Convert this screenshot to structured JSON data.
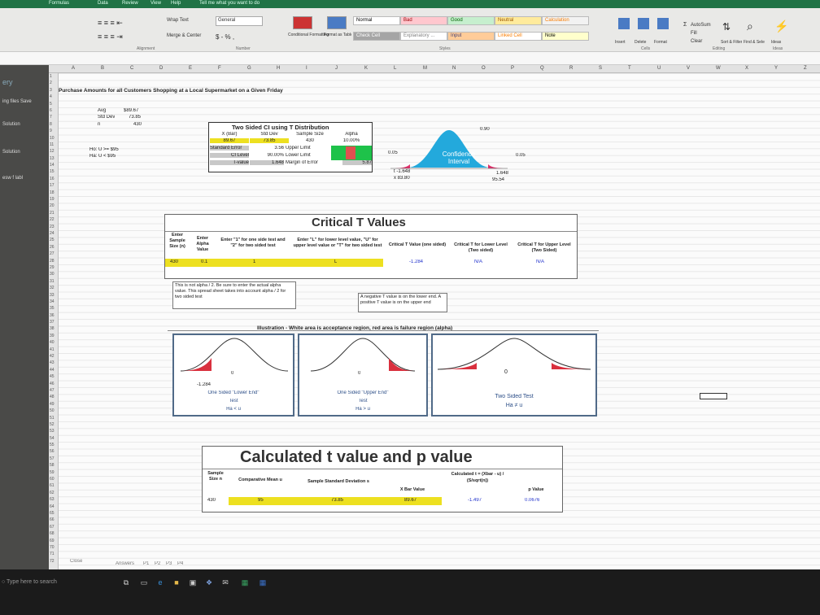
{
  "ribbon": {
    "tabs": [
      "Formulas",
      "Data",
      "Review",
      "View",
      "Help",
      "Tell me what you want to do"
    ],
    "wrap_text": "Wrap Text",
    "merge_center": "Merge & Center",
    "number_format": "General",
    "currency_symbols": "$ - % ,",
    "conditional_formatting": "Conditional Formatting",
    "format_as_table": "Format as Table",
    "styles": [
      {
        "label": "Normal",
        "bg": "#ffffff",
        "fg": "#000000"
      },
      {
        "label": "Bad",
        "bg": "#ffc7ce",
        "fg": "#9c0006"
      },
      {
        "label": "Good",
        "bg": "#c6efce",
        "fg": "#006100"
      },
      {
        "label": "Neutral",
        "bg": "#ffeb9c",
        "fg": "#9c5700"
      },
      {
        "label": "Calculation",
        "bg": "#f2f2f2",
        "fg": "#fa7d00"
      },
      {
        "label": "Check Cell",
        "bg": "#a5a5a5",
        "fg": "#ffffff"
      },
      {
        "label": "Explanatory ...",
        "bg": "#ffffff",
        "fg": "#7f7f7f"
      },
      {
        "label": "Input",
        "bg": "#ffcc99",
        "fg": "#3f3f76"
      },
      {
        "label": "Linked Cell",
        "bg": "#ffffff",
        "fg": "#fa7d00"
      },
      {
        "label": "Note",
        "bg": "#ffffcc",
        "fg": "#000000"
      }
    ],
    "cells": [
      "Insert",
      "Delete",
      "Format"
    ],
    "autosum": "AutoSum",
    "fill": "Fill",
    "clear": "Clear",
    "sort_filter": "Sort & Filter",
    "find_select": "Find & Select",
    "ideas": "Ideas",
    "groups": [
      "Alignment",
      "Number",
      "Styles",
      "Cells",
      "Editing",
      "Ideas"
    ]
  },
  "columns": [
    "A",
    "B",
    "C",
    "D",
    "E",
    "F",
    "G",
    "H",
    "I",
    "J",
    "K",
    "L",
    "M",
    "N",
    "O",
    "P",
    "Q",
    "R",
    "S",
    "T",
    "U",
    "V",
    "W",
    "X",
    "Y",
    "Z"
  ],
  "left_pane": [
    "ery",
    "ing files Save",
    "Solution",
    "Solution",
    "esw f labl"
  ],
  "sheet": {
    "title": "Purchase Amounts for all Customers Shopping at a Local Supermarket on a Given Friday",
    "stats": {
      "avg_label": "Avg",
      "avg": "$89.67",
      "sd_label": "Std Dev",
      "sd": "73.85",
      "n_label": "n",
      "n": "430"
    },
    "hypotheses": {
      "h0": "Ho: U >= $95",
      "ha": "Ha: U < $95"
    },
    "ci_table": {
      "title": "Two Sided CI using T Distribution",
      "headers": [
        "X (Bar)",
        "Std Dev",
        "Sample Size",
        "Alpha"
      ],
      "values": [
        "89.67",
        "73.85",
        "430",
        "10.00%"
      ],
      "row_std_err": {
        "label": "Standard Error",
        "value": "3.56",
        "desc": "Upper Limit"
      },
      "row_ci_level": {
        "label": "CI Level",
        "value": "90.00%",
        "desc": "Lower Limit"
      },
      "row_tvalue": {
        "label": "T-value",
        "value": "1.648",
        "desc": "Margin of Error",
        "moe": "5.87"
      }
    },
    "ci_chart": {
      "center_label": "Confidence Interval",
      "center_value": "0.90",
      "left_tail": "0.05",
      "right_tail": "0.05",
      "t_left": "t  -1.648",
      "x_left": "x  83.80",
      "t_right": "1.648",
      "x_right": "95.54"
    },
    "critical": {
      "title": "Critical T Values",
      "headers": [
        "Enter Sample Size (n)",
        "Enter Alpha Value",
        "Enter \"1\" for one side test and \"2\" for two sided test",
        "Enter \"L\" for lower level value, \"U\" for upper level value or \"T\" for two sided test",
        "Critical T Value (one sided)",
        "Critical T for Lower Level (Two sided)",
        "Critical T for Upper Level (Two Sided)"
      ],
      "values": [
        "430",
        "0.1",
        "1",
        "L",
        "-1.284",
        "N/A",
        "N/A"
      ],
      "note_alpha": "This is not alpha / 2.  Be sure to enter the actual alpha value.  This spread sheet takes into account alpha / 2 for two sided test",
      "note_neg": "A negative T value is on the lower end.  A positive T value is on the upper end"
    },
    "illustration": {
      "title": "Illustration - White area is acceptance region, red area is failure region (alpha)",
      "panels": [
        {
          "zero": "0",
          "t": "-1.284",
          "line1": "One Sided \"Lower End\"",
          "line2": "Test",
          "line3": "Ha < u"
        },
        {
          "zero": "0",
          "t": "",
          "line1": "One Sided \"Upper End\"",
          "line2": "Test",
          "line3": "Ha > u"
        },
        {
          "zero": "0",
          "t": "",
          "line1": "Two Sided Test",
          "line2": "Ha ≠ u",
          "line3": ""
        }
      ]
    },
    "calc": {
      "title": "Calculated t value and p value",
      "headers": [
        "Sample Size n",
        "Comparative Mean u",
        "Sample Standard Deviation s",
        "X Bar Value",
        "Calculated t = (Xbar - u) / (S/sqrt(n))",
        "p Value"
      ],
      "values": [
        "430",
        "95",
        "73.85",
        "89.67",
        "-1.497",
        "0.0676"
      ]
    }
  },
  "sheet_tabs": [
    "Close",
    "Answers",
    "P1",
    "P2",
    "P3",
    "P4"
  ],
  "taskbar": {
    "search_placeholder": "Type here to search"
  }
}
